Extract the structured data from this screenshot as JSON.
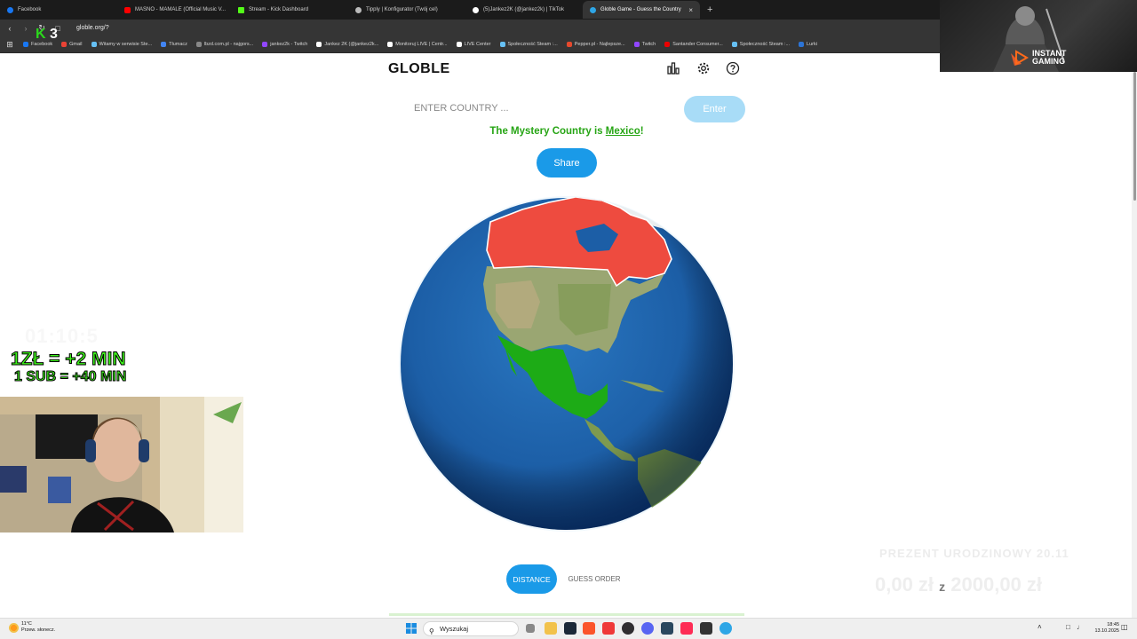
{
  "browser": {
    "tabs": [
      {
        "title": "Facebook",
        "color": "#1877f2",
        "active": false
      },
      {
        "title": "MASNO - MAMALE (Official Music V...",
        "color": "#ff0000",
        "active": false
      },
      {
        "title": "Stream - Kick Dashboard",
        "color": "#53fc18",
        "active": false
      },
      {
        "title": "Tipply | Konfigurator (Twój cel)",
        "color": "#bbbbbb",
        "active": false
      },
      {
        "title": "(5)Jankez2K (@jankez2k) | TikTok",
        "color": "#ffffff",
        "active": false
      },
      {
        "title": "Globle Game - Guess the Country",
        "color": "#2ea6e6",
        "active": true
      }
    ],
    "new_tab": "+",
    "tab_close": "×",
    "url": "globle.org/?",
    "bookmarks": [
      {
        "label": "Facebook",
        "color": "#1877f2"
      },
      {
        "label": "Gmail",
        "color": "#ea4335"
      },
      {
        "label": "Witamy w serwisie Ste...",
        "color": "#66c0f4"
      },
      {
        "label": "Tłumacz",
        "color": "#4285f4"
      },
      {
        "label": "lbzd.com.pl - najgors...",
        "color": "#888888"
      },
      {
        "label": "jankez2k - Twitch",
        "color": "#9146ff"
      },
      {
        "label": "Jankez 2K (@jankez2k...",
        "color": "#ffffff"
      },
      {
        "label": "Monitoruj LIVE | Centr...",
        "color": "#ffffff"
      },
      {
        "label": "LIVE Center",
        "color": "#ffffff"
      },
      {
        "label": "Społeczność Steam :...",
        "color": "#66c0f4"
      },
      {
        "label": "Pepper.pl - Najlepsze...",
        "color": "#e6492d"
      },
      {
        "label": "Twitch",
        "color": "#9146ff"
      },
      {
        "label": "Santander Consumer...",
        "color": "#ec0000"
      },
      {
        "label": "Społeczność Steam :...",
        "color": "#66c0f4"
      },
      {
        "label": "Lurki",
        "color": "#2c74d6"
      }
    ]
  },
  "globle": {
    "logo": "GLOBLE",
    "input_placeholder": "ENTER COUNTRY ...",
    "enter_label": "Enter",
    "result_prefix": "The Mystery Country is ",
    "result_country": "Mexico",
    "result_suffix": "!",
    "share_label": "Share",
    "tab_distance": "DISTANCE",
    "tab_guess_order": "GUESS ORDER",
    "colors": {
      "accent": "#1a9ae8",
      "correct": "#27a515",
      "guess": "#ee4b3f",
      "ocean": "#1d5fa8"
    }
  },
  "overlay": {
    "counter_k": "K",
    "counter_num": "3",
    "timer": "01:10:5",
    "promo_line1": "1ZŁ = +2 MIN",
    "promo_line2": "1 SUB = +40 MIN",
    "brand_line1": "INSTANT",
    "brand_line2": "GAMING",
    "gift_title": "PREZENT URODZINOWY 20.11",
    "gift_current": "0,00 zł",
    "gift_separator": "z",
    "gift_goal": "2000,00 zł"
  },
  "taskbar": {
    "weather_temp": "11°C",
    "weather_desc": "Przew. słonecz.",
    "search_label": "Wyszukaj",
    "time": "18:45",
    "date": "13.10.2025"
  }
}
